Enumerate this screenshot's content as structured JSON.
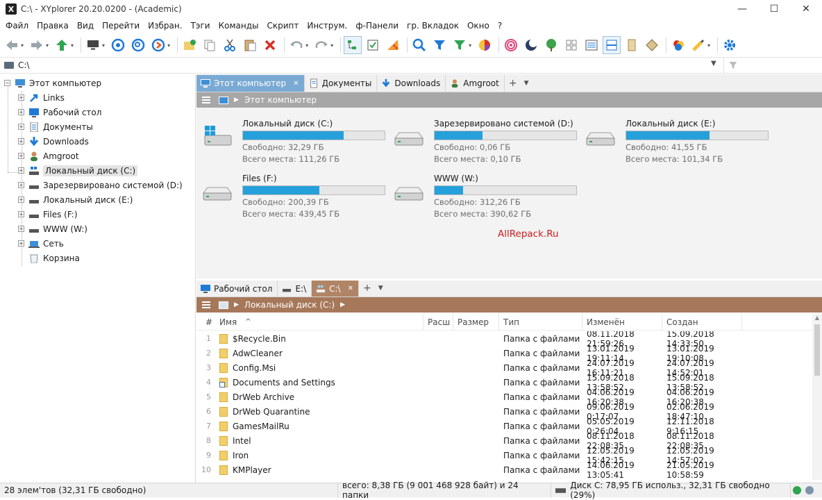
{
  "window": {
    "title": "C:\\ - XYplorer 20.20.0200 - (Academic)",
    "app_icon_glyph": "X",
    "minimize": "—",
    "maximize": "☐",
    "close": "✕"
  },
  "menu": [
    "Файл",
    "Правка",
    "Вид",
    "Перейти",
    "Избран.",
    "Тэги",
    "Команды",
    "Скрипт",
    "Инструм.",
    "ф-Панели",
    "гр. Вкладок",
    "Окно",
    "?"
  ],
  "toolbar": {
    "icons": [
      "back-icon",
      "forward-icon",
      "up-icon",
      "computer-icon",
      "target-icon",
      "search-location-icon",
      "go-icon",
      "new-folder-icon",
      "copy-icon",
      "cut-icon",
      "paste-icon",
      "delete-icon",
      "undo-icon",
      "redo-icon",
      "tree-icon",
      "checkbox-icon",
      "pizza-icon",
      "find-icon",
      "filter-icon",
      "filter-green-icon",
      "pie-chart-icon",
      "spiral-icon",
      "moon-icon",
      "tree-green-icon",
      "grid-icon",
      "details-icon",
      "split-icon",
      "pane-icon",
      "tag-icon",
      "color-circles-icon",
      "brush-icon",
      "settings-icon"
    ],
    "accent": "#1f7ad6"
  },
  "address": {
    "value": "C:\\"
  },
  "tree": {
    "root": "Этот компьютер",
    "items": [
      "Links",
      "Рабочий стол",
      "Документы",
      "Downloads",
      "Amgroot",
      "Локальный диск (C:)",
      "Зарезервировано системой (D:)",
      "Локальный диск (E:)",
      "Files (F:)",
      "WWW (W:)",
      "Сеть",
      "Корзина"
    ]
  },
  "pane1": {
    "tabs": [
      "Этот компьютер",
      "Документы",
      "Downloads",
      "Amgroot"
    ],
    "add_tab": "+",
    "breadcrumb": "Этот компьютер",
    "drives": [
      {
        "name": "Локальный диск (C:)",
        "free": "Свободно: 32,29 ГБ",
        "total": "Всего места: 111,26 ГБ",
        "used_fraction": 0.71
      },
      {
        "name": "Зарезервировано системой (D:)",
        "free": "Свободно: 0,06 ГБ",
        "total": "Всего места: 0,10 ГБ",
        "used_fraction": 0.34
      },
      {
        "name": "Локальный диск (E:)",
        "free": "Свободно: 41,55 ГБ",
        "total": "Всего места: 101,34 ГБ",
        "used_fraction": 0.59
      },
      {
        "name": "Files (F:)",
        "free": "Свободно: 200,39 ГБ",
        "total": "Всего места: 439,45 ГБ",
        "used_fraction": 0.54
      },
      {
        "name": "WWW (W:)",
        "free": "Свободно: 312,26 ГБ",
        "total": "Всего места: 390,62 ГБ",
        "used_fraction": 0.2
      }
    ],
    "watermark": "AllRepack.Ru"
  },
  "pane2": {
    "tabs": [
      "Рабочий стол",
      "E:\\",
      "C:\\"
    ],
    "add_tab": "+",
    "breadcrumb": "Локальный диск (C:)",
    "columns": [
      "#",
      "Имя",
      "Расш",
      "Размер",
      "Тип",
      "Изменён",
      "Создан"
    ],
    "sort_indicator": "^",
    "rows": [
      {
        "n": "1",
        "name": "$Recycle.Bin",
        "type": "Папка с файлами",
        "mod": "08.11.2018 21:59:26",
        "cre": "15.09.2018 14:33:50"
      },
      {
        "n": "2",
        "name": "AdwCleaner",
        "type": "Папка с файлами",
        "mod": "13.01.2019 19:11:14",
        "cre": "13.01.2019 19:10:08"
      },
      {
        "n": "3",
        "name": "Config.Msi",
        "type": "Папка с файлами",
        "mod": "24.07.2019 16:11:21",
        "cre": "24.07.2019 14:52:01"
      },
      {
        "n": "4",
        "name": "Documents and Settings",
        "type": "Папка с файлами",
        "mod": "15.09.2018 13:58:52",
        "cre": "15.09.2018 13:58:52",
        "link": true
      },
      {
        "n": "5",
        "name": "DrWeb Archive",
        "type": "Папка с файлами",
        "mod": "04.06.2019 16:20:38",
        "cre": "04.06.2019 16:20:38"
      },
      {
        "n": "6",
        "name": "DrWeb Quarantine",
        "type": "Папка с файлами",
        "mod": "09.06.2019 0:17:07",
        "cre": "02.06.2019 18:47:10"
      },
      {
        "n": "7",
        "name": "GamesMailRu",
        "type": "Папка с файлами",
        "mod": "05.05.2019 0:26:04",
        "cre": "12.11.2018 9:16:15"
      },
      {
        "n": "8",
        "name": "Intel",
        "type": "Папка с файлами",
        "mod": "08.11.2018 22:08:35",
        "cre": "08.11.2018 22:08:35"
      },
      {
        "n": "9",
        "name": "Iron",
        "type": "Папка с файлами",
        "mod": "12.05.2019 15:42:15",
        "cre": "12.05.2019 14:57:02"
      },
      {
        "n": "10",
        "name": "KMPlayer",
        "type": "Папка с файлами",
        "mod": "14.06.2019 13:05:41",
        "cre": "21.05.2019 10:58:59"
      }
    ]
  },
  "status": {
    "items": "28 элем'тов (32,31 ГБ свободно)",
    "total": "всего: 8,38 ГБ (9 001 468 928 байт) и 24 папки",
    "disk": "Диск С:  78,95 ГБ использ.,    32,31 ГБ свободно (29%)"
  }
}
